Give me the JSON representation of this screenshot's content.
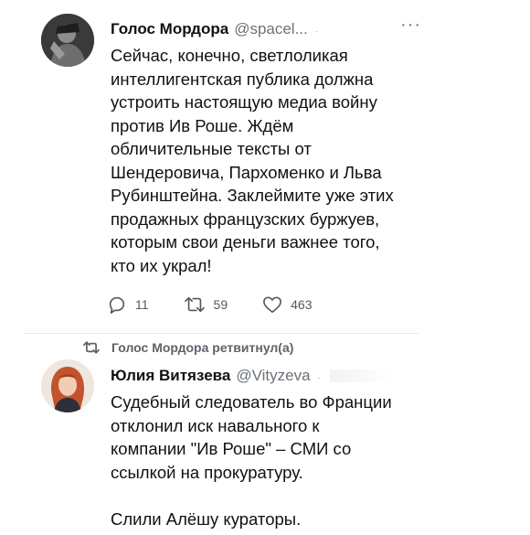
{
  "tweet1": {
    "author_name": "Голос Мордора",
    "author_handle": "@spacel...",
    "handle_dot": "·",
    "more": "···",
    "text": "Сейчас, конечно, светлоликая\nинтеллигентская публика должна\nустроить настоящую медиа войну\nпротив Ив Роше. Ждём\nобличительные тексты от\nШендеровича, Пархоменко и Льва\nРубинштейна. Заклеймите уже этих\nпродажных французских буржуев,\nкоторым свои деньги важнее того,\nкто их украл!",
    "replies": "11",
    "retweets": "59",
    "likes": "463"
  },
  "retweet_banner": {
    "text": "Голос Мордора ретвитнул(а)"
  },
  "tweet2": {
    "author_name": "Юлия Витязева",
    "author_handle": "@Vityzeva",
    "handle_dot": "·",
    "text": "Судебный следователь во Франции\nотклонил иск навального к\nкомпании \"Ив Роше\" – СМИ со\nссылкой на прокуратуру.\n\nСлили Алёшу кураторы."
  },
  "icons": {
    "reply": "reply-icon",
    "retweet": "retweet-icon",
    "like": "heart-icon",
    "more": "more-icon"
  }
}
